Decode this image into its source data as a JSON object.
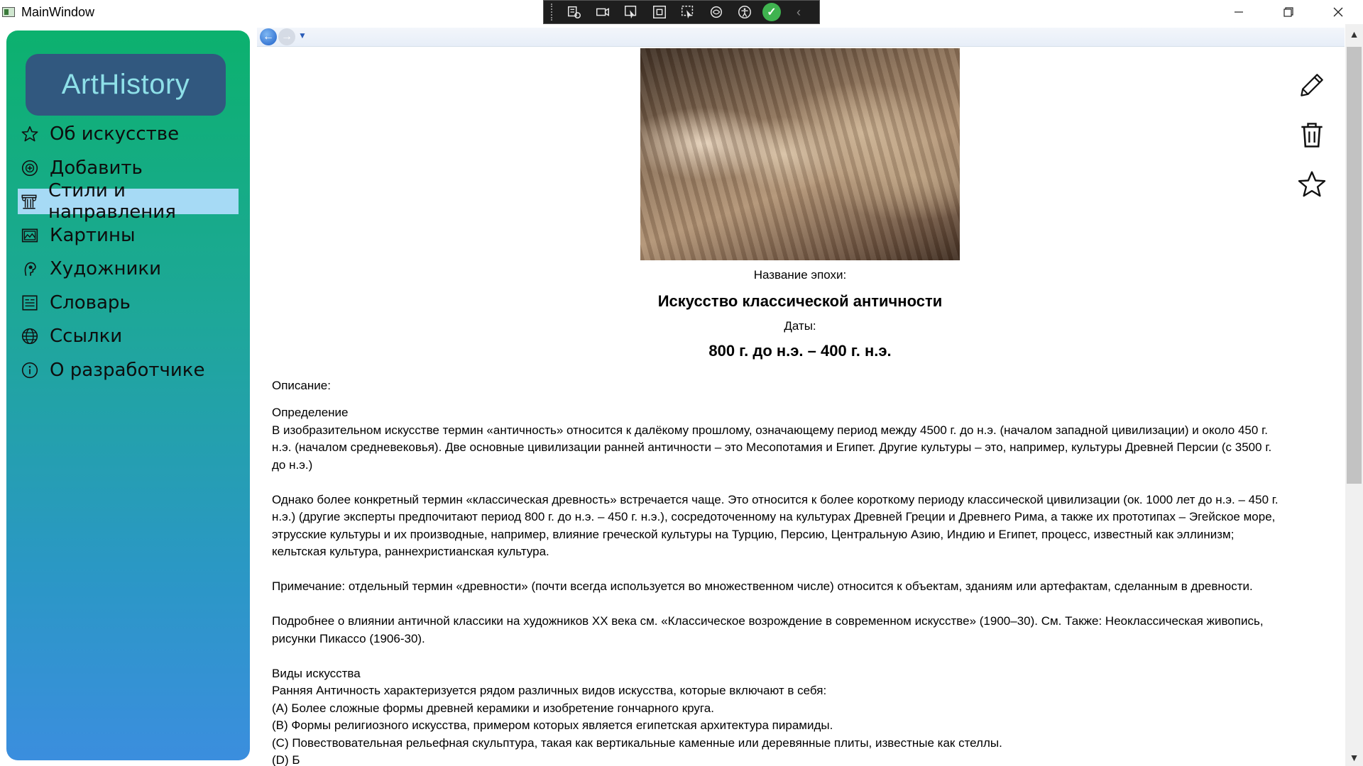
{
  "window": {
    "title": "MainWindow"
  },
  "sidebar": {
    "logo": "ArtHistory",
    "items": [
      {
        "label": "Об искусстве",
        "icon": "star-icon"
      },
      {
        "label": "Добавить",
        "icon": "add-circle-icon"
      },
      {
        "label": "Стили и направления",
        "icon": "column-icon",
        "active": true
      },
      {
        "label": "Картины",
        "icon": "picture-icon"
      },
      {
        "label": "Художники",
        "icon": "artist-icon"
      },
      {
        "label": "Словарь",
        "icon": "dictionary-icon"
      },
      {
        "label": "Ссылки",
        "icon": "globe-icon"
      },
      {
        "label": "О разработчике",
        "icon": "info-icon"
      }
    ]
  },
  "era": {
    "label": "Название эпохи:",
    "name": "Искусство классической античности",
    "dates_label": "Даты:",
    "dates": "800 г. до н.э. – 400 г. н.э."
  },
  "description": {
    "label": "Описание:",
    "lines": [
      "Определение",
      "В изобразительном искусстве термин «античность» относится к далёкому прошлому, означающему период между 4500 г. до н.э. (началом западной цивилизации) и около 450 г.",
      "н.э. (началом средневековья). Две основные цивилизации ранней античности – это Месопотамия и Египет. Другие культуры – это, например, культуры Древней Персии (с 3500 г.",
      "до н.э.)",
      "",
      "Однако более конкретный термин «классическая древность» встречается чаще. Это относится к более короткому периоду классической цивилизации (ок. 1000 лет до н.э. – 450 г.",
      "н.э.) (другие эксперты предпочитают период 800 г. до н.э. – 450 г. н.э.), сосредоточенному на культурах Древней Греции и Древнего Рима, а также их прототипах – Эгейское море,",
      "этрусские культуры и их производные, например, влияние греческой культуры на Турцию, Персию, Центральную Азию, Индию и Египет, процесс, известный как эллинизм;",
      "кельтская культура, раннехристианская культура.",
      "",
      "Примечание: отдельный термин «древности» (почти всегда используется во множественном числе) относится к объектам, зданиям или артефактам, сделанным в древности.",
      "",
      "Подробнее о влиянии античной классики на художников XX века см. «Классическое возрождение в современном искусстве» (1900–30). См. Также: Неоклассическая живопись,",
      "рисунки Пикассо (1906-30).",
      "",
      "Виды искусства",
      "Ранняя Античность характеризуется рядом различных видов искусства, которые включают в себя:",
      "(A) Более сложные формы древней керамики и изобретение гончарного круга.",
      "(B) Формы религиозного искусства, примером которых является египетская архитектура пирамиды.",
      "(C) Повествовательная рельефная скульптура, такая как вертикальные каменные или деревянные плиты, известные как стеллы.",
      "(D) Б"
    ]
  },
  "actions": {
    "edit_icon": "pencil-icon",
    "delete_icon": "trash-icon",
    "favorite_icon": "star-outline-icon"
  }
}
